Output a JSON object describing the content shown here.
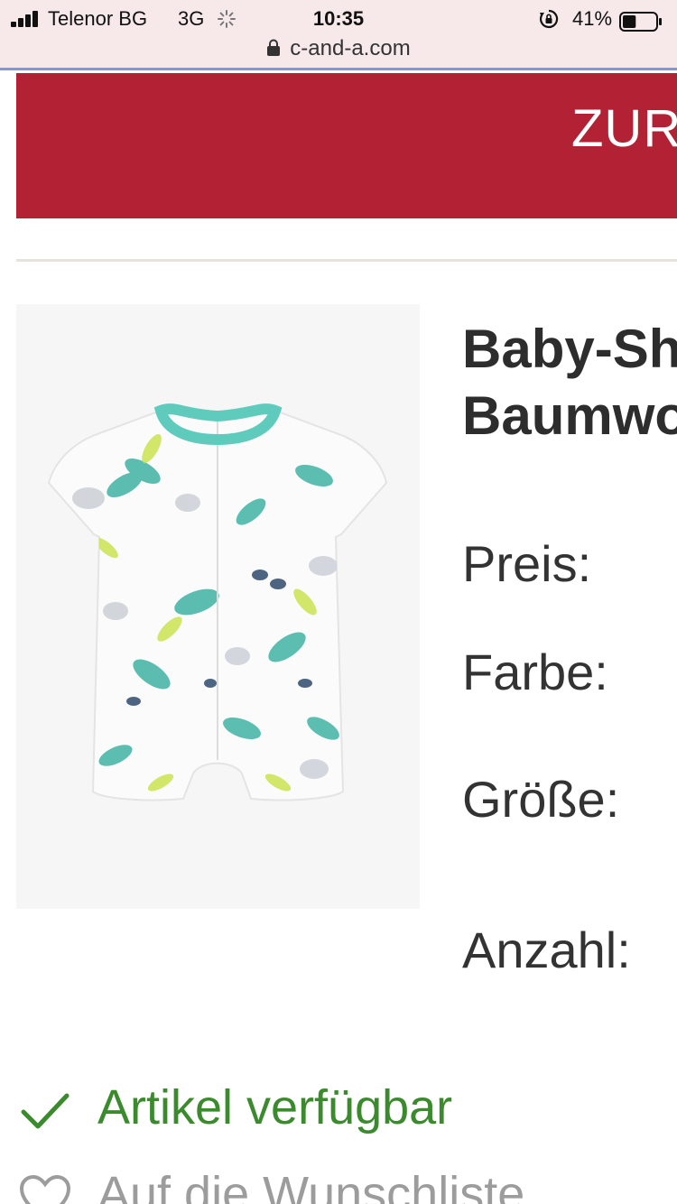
{
  "status_bar": {
    "carrier": "Telenor BG",
    "network": "3G",
    "time": "10:35",
    "battery": "41%",
    "battery_level": 0.41
  },
  "browser": {
    "url": "c-and-a.com"
  },
  "banner": {
    "text": "ZUR",
    "color": "#b22234"
  },
  "product": {
    "title_line1": "Baby-Sh",
    "title_line2": "Baumwo",
    "image_icon": "baby-romper-image"
  },
  "details": {
    "price_label": "Preis:",
    "color_label": "Farbe:",
    "size_label": "Größe:",
    "quantity_label": "Anzahl:"
  },
  "availability": {
    "icon": "checkmark-icon",
    "text": "Artikel verfügbar",
    "color": "#3c8a2e"
  },
  "wishlist": {
    "icon": "heart-icon",
    "text": "Auf die Wunschliste"
  }
}
